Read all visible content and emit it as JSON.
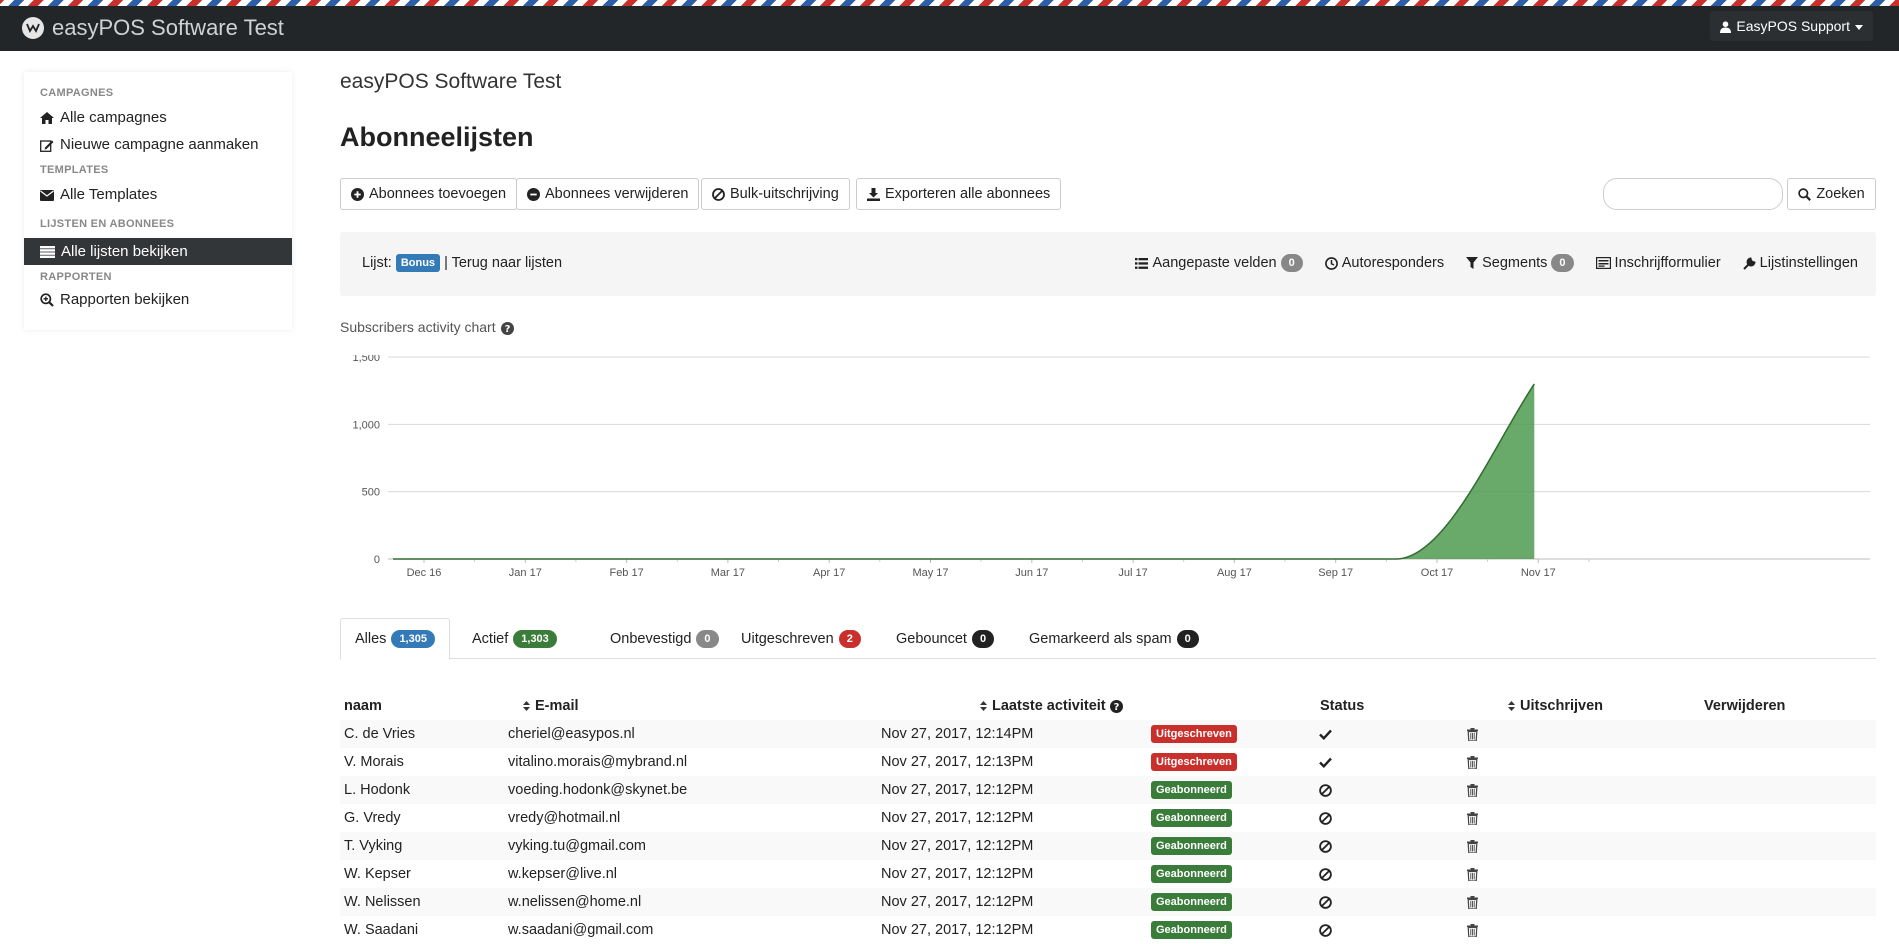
{
  "app": {
    "title": "easyPOS Software Test",
    "user_menu": "EasyPOS Support"
  },
  "sidebar": {
    "sections": [
      {
        "header": "CAMPAGNES",
        "items": [
          {
            "label": "Alle campagnes",
            "icon": "home-icon"
          },
          {
            "label": "Nieuwe campagne aanmaken",
            "icon": "edit-icon"
          }
        ]
      },
      {
        "header": "TEMPLATES",
        "items": [
          {
            "label": "Alle Templates",
            "icon": "envelope-icon"
          }
        ]
      },
      {
        "header": "LIJSTEN EN ABONNEES",
        "items": [
          {
            "label": "Alle lijsten bekijken",
            "icon": "list-icon",
            "active": true
          }
        ]
      },
      {
        "header": "RAPPORTEN",
        "items": [
          {
            "label": "Rapporten bekijken",
            "icon": "search-plus-icon"
          }
        ]
      }
    ]
  },
  "page": {
    "title": "easyPOS Software Test",
    "section_title": "Abonneelijsten"
  },
  "toolbar": {
    "add": "Abonnees toevoegen",
    "remove": "Abonnees verwijderen",
    "bulk_unsubscribe": "Bulk-uitschrijving",
    "export": "Exporteren alle abonnees",
    "search_button": "Zoeken",
    "search_value": ""
  },
  "listbar": {
    "list_label": "Lijst:",
    "list_name": "Bonus",
    "back_link": "| Terug naar lijsten",
    "custom_fields": "Aangepaste velden",
    "custom_fields_count": "0",
    "autoresponders": "Autoresponders",
    "segments": "Segments",
    "segments_count": "0",
    "signup_form": "Inschrijfformulier",
    "list_settings": "Lijstinstellingen"
  },
  "chart_title": "Subscribers activity chart",
  "chart_data": {
    "type": "area",
    "title": "Subscribers activity chart",
    "categories": [
      "Dec 16",
      "Jan 17",
      "Feb 17",
      "Mar 17",
      "Apr 17",
      "May 17",
      "Jun 17",
      "Jul 17",
      "Aug 17",
      "Sep 17",
      "Oct 17",
      "Nov 17"
    ],
    "y_ticks": [
      "1,500",
      "1,000",
      "500",
      "0"
    ],
    "ylim": [
      0,
      1500
    ],
    "series": [
      {
        "values": [
          0,
          0,
          0,
          0,
          0,
          0,
          0,
          0,
          0,
          0,
          0,
          1300
        ]
      }
    ],
    "color": "#4f9a4f",
    "grid": true
  },
  "tabs": [
    {
      "label": "Alles",
      "count": "1,305",
      "badge": "b-blue",
      "active": true
    },
    {
      "label": "Actief",
      "count": "1,303",
      "badge": "b-green"
    },
    {
      "label": "Onbevestigd",
      "count": "0",
      "badge": "b-gray"
    },
    {
      "label": "Uitgeschreven",
      "count": "2",
      "badge": "b-red"
    },
    {
      "label": "Gebouncet",
      "count": "0",
      "badge": "b-dark"
    },
    {
      "label": "Gemarkeerd als spam",
      "count": "0",
      "badge": "b-dark"
    }
  ],
  "table": {
    "headers": {
      "name": "naam",
      "email": "E-mail",
      "last_activity": "Laatste activiteit",
      "status": "Status",
      "unsubscribe": "Uitschrijven",
      "delete": "Verwijderen"
    },
    "rows": [
      {
        "name": "C. de Vries",
        "email": "cheriel@easypos.nl",
        "activity": "Nov 27, 2017, 12:14PM",
        "status": "Uitgeschreven",
        "status_color": "#c9302c",
        "unsub": "check-icon"
      },
      {
        "name": "V. Morais",
        "email": "vitalino.morais@mybrand.nl",
        "activity": "Nov 27, 2017, 12:13PM",
        "status": "Uitgeschreven",
        "status_color": "#c9302c",
        "unsub": "check-icon"
      },
      {
        "name": "L. Hodonk",
        "email": "voeding.hodonk@skynet.be",
        "activity": "Nov 27, 2017, 12:12PM",
        "status": "Geabonneerd",
        "status_color": "#3a7d3a",
        "unsub": "ban-icon"
      },
      {
        "name": "G. Vredy",
        "email": "vredy@hotmail.nl",
        "activity": "Nov 27, 2017, 12:12PM",
        "status": "Geabonneerd",
        "status_color": "#3a7d3a",
        "unsub": "ban-icon"
      },
      {
        "name": "T. Vyking",
        "email": "vyking.tu@gmail.com",
        "activity": "Nov 27, 2017, 12:12PM",
        "status": "Geabonneerd",
        "status_color": "#3a7d3a",
        "unsub": "ban-icon"
      },
      {
        "name": "W. Kepser",
        "email": "w.kepser@live.nl",
        "activity": "Nov 27, 2017, 12:12PM",
        "status": "Geabonneerd",
        "status_color": "#3a7d3a",
        "unsub": "ban-icon"
      },
      {
        "name": "W. Nelissen",
        "email": "w.nelissen@home.nl",
        "activity": "Nov 27, 2017, 12:12PM",
        "status": "Geabonneerd",
        "status_color": "#3a7d3a",
        "unsub": "ban-icon"
      },
      {
        "name": "W. Saadani",
        "email": "w.saadani@gmail.com",
        "activity": "Nov 27, 2017, 12:12PM",
        "status": "Geabonneerd",
        "status_color": "#3a7d3a",
        "unsub": "ban-icon"
      }
    ]
  }
}
